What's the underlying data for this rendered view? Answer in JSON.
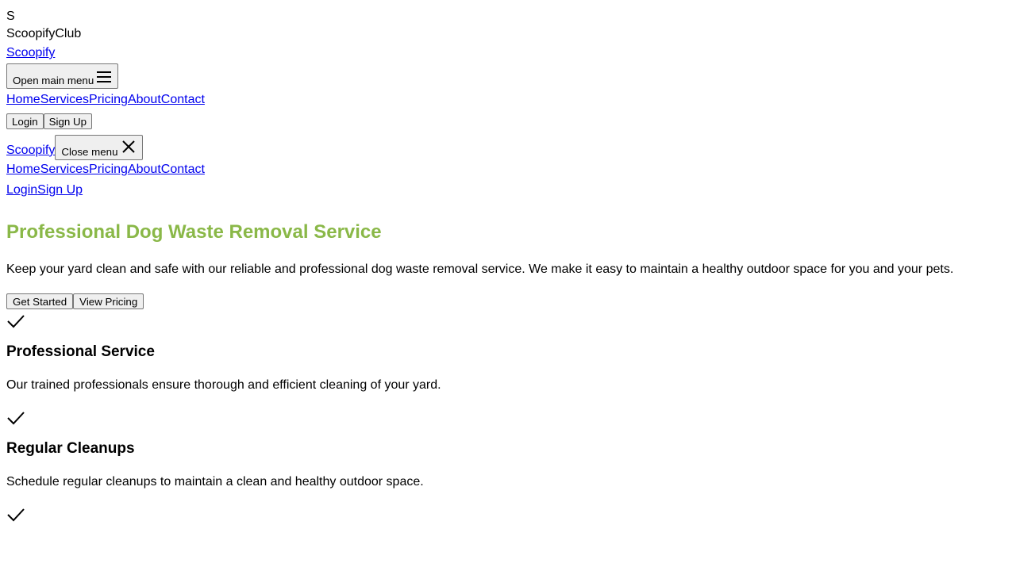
{
  "logo": {
    "letter": "S",
    "name": "ScoopifyClub"
  },
  "header": {
    "brand_link": "Scoopify",
    "open_menu_label": "Open main menu",
    "nav": [
      "Home",
      "Services",
      "Pricing",
      "About",
      "Contact"
    ],
    "login_label": "Login",
    "signup_label": "Sign Up"
  },
  "mobile_menu": {
    "brand_link": "Scoopify",
    "close_menu_label": "Close menu",
    "nav": [
      "Home",
      "Services",
      "Pricing",
      "About",
      "Contact"
    ],
    "login_label": "Login",
    "signup_label": "Sign Up"
  },
  "hero": {
    "title": "Professional Dog Waste Removal Service",
    "description": "Keep your yard clean and safe with our reliable and professional dog waste removal service. We make it easy to maintain a healthy outdoor space for you and your pets.",
    "get_started_label": "Get Started",
    "view_pricing_label": "View Pricing",
    "title_color": "#8ab848"
  },
  "features": [
    {
      "icon": "check-icon",
      "title": "Professional Service",
      "description": "Our trained professionals ensure thorough and efficient cleaning of your yard."
    },
    {
      "icon": "check-icon",
      "title": "Regular Cleanups",
      "description": "Schedule regular cleanups to maintain a clean and healthy outdoor space."
    },
    {
      "icon": "check-icon"
    }
  ]
}
